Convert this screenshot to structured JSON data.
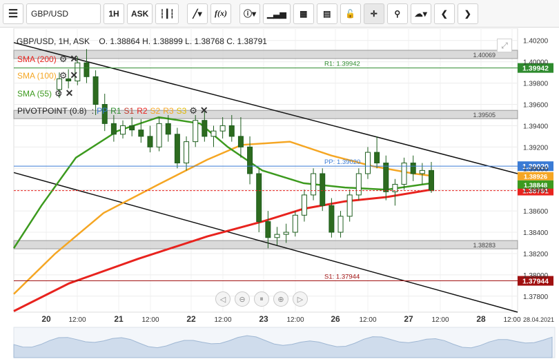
{
  "toolbar": {
    "menu_icon": "hamburger-icon",
    "symbol": "GBP/USD",
    "timeframe": "1H",
    "price_type": "ASK",
    "icons": [
      "candles-icon",
      "draw-icon",
      "fx-icon",
      "info-icon",
      "volume-icon",
      "calendar-icon",
      "news-icon",
      "lock-icon",
      "crosshair-icon",
      "zoom-icon",
      "cloud-icon",
      "prev-icon",
      "next-icon"
    ],
    "fx_label": "f(x)"
  },
  "header": {
    "instrument": "GBP/USD, 1H, ASK",
    "ohlc": "O. 1.38864 H. 1.38899 L. 1.38768 C. 1.38791"
  },
  "indicators": [
    {
      "label": "SMA (200)",
      "color": "#e8231e"
    },
    {
      "label": "SMA (100)",
      "color": "#f5a623"
    },
    {
      "label": "SMA (55)",
      "color": "#3c9a1e"
    }
  ],
  "pivot": {
    "label": "PIVOTPOINT (0.8)",
    "items": [
      {
        "label": "PP",
        "color": "#3a7bd5"
      },
      {
        "label": "R1",
        "color": "#2e8b2e"
      },
      {
        "label": "S1",
        "color": "#c0392b"
      },
      {
        "label": "R2",
        "color": "#e8231e"
      },
      {
        "label": "S2",
        "color": "#f5a623"
      },
      {
        "label": "R3",
        "color": "#f5a623"
      },
      {
        "label": "S3",
        "color": "#f5c518"
      }
    ]
  },
  "chart_data": {
    "type": "line",
    "title": "GBP/USD, 1H, ASK",
    "ylim": [
      1.3765,
      1.4025
    ],
    "x_tick_labels": [
      "20",
      "12:00",
      "21",
      "12:00",
      "22",
      "12:00",
      "23",
      "12:00",
      "26",
      "12:00",
      "27",
      "12:00",
      "28",
      "12:00",
      "28.04.2021"
    ],
    "y_tick_labels": [
      "1.40200",
      "1.40000",
      "1.39800",
      "1.39600",
      "1.39400",
      "1.39200",
      "1.39000",
      "1.38800",
      "1.38600",
      "1.38400",
      "1.38200",
      "1.38000",
      "1.37800"
    ],
    "y_ticks": [
      1.402,
      1.4,
      1.398,
      1.396,
      1.394,
      1.392,
      1.39,
      1.388,
      1.386,
      1.384,
      1.382,
      1.38,
      1.378
    ],
    "levels": [
      {
        "name": "R1",
        "label": "R1: 1.39942",
        "value": 1.39942,
        "tag": "1.39942",
        "color": "#2e8b2e"
      },
      {
        "name": "PP",
        "label": "PP: 1.39020",
        "value": 1.3902,
        "tag": "1.39020",
        "color": "#3a7bd5"
      },
      {
        "name": "S1",
        "label": "S1: 1.37944",
        "value": 1.37944,
        "tag": "1.37944",
        "color": "#a01010"
      },
      {
        "name": "Close",
        "label": "",
        "value": 1.38791,
        "tag": "1.38791",
        "color": "#e8231e"
      }
    ],
    "sma_tags": [
      {
        "name": "SMA (100)",
        "value": 1.38926,
        "tag": "1.38926",
        "color": "#f5a623"
      },
      {
        "name": "SMA (55)",
        "value": 1.38848,
        "tag": "1.38848",
        "color": "#3c9a1e"
      }
    ],
    "zones": [
      {
        "label": "1.40069",
        "value": 1.40069
      },
      {
        "label": "1.39505",
        "value": 1.39505
      },
      {
        "label": "1.38283",
        "value": 1.38283
      }
    ],
    "candles": [
      [
        1.3974,
        1.399,
        1.3966,
        1.3984
      ],
      [
        1.3984,
        1.3993,
        1.3975,
        1.3982
      ],
      [
        1.3982,
        1.4005,
        1.3978,
        1.3999
      ],
      [
        1.3999,
        1.4012,
        1.398,
        1.3986
      ],
      [
        1.3986,
        1.3992,
        1.395,
        1.396
      ],
      [
        1.396,
        1.397,
        1.3935,
        1.3942
      ],
      [
        1.3942,
        1.395,
        1.3925,
        1.3932
      ],
      [
        1.3932,
        1.3945,
        1.3928,
        1.394
      ],
      [
        1.394,
        1.3948,
        1.393,
        1.3936
      ],
      [
        1.3936,
        1.3946,
        1.3924,
        1.393
      ],
      [
        1.393,
        1.394,
        1.3915,
        1.392
      ],
      [
        1.392,
        1.3948,
        1.3916,
        1.3942
      ],
      [
        1.3942,
        1.395,
        1.3925,
        1.3932
      ],
      [
        1.3932,
        1.3938,
        1.39,
        1.3905
      ],
      [
        1.3905,
        1.393,
        1.3898,
        1.3925
      ],
      [
        1.3925,
        1.395,
        1.392,
        1.3945
      ],
      [
        1.3945,
        1.3955,
        1.3925,
        1.393
      ],
      [
        1.393,
        1.394,
        1.392,
        1.3935
      ],
      [
        1.3935,
        1.3948,
        1.3928,
        1.394
      ],
      [
        1.394,
        1.395,
        1.3925,
        1.393
      ],
      [
        1.393,
        1.3948,
        1.391,
        1.392
      ],
      [
        1.392,
        1.393,
        1.3885,
        1.3895
      ],
      [
        1.3895,
        1.39,
        1.384,
        1.385
      ],
      [
        1.385,
        1.386,
        1.3825,
        1.3835
      ],
      [
        1.3835,
        1.3845,
        1.3828,
        1.3838
      ],
      [
        1.3838,
        1.3848,
        1.383,
        1.384
      ],
      [
        1.384,
        1.386,
        1.3836,
        1.3856
      ],
      [
        1.3856,
        1.388,
        1.385,
        1.3875
      ],
      [
        1.3875,
        1.39,
        1.387,
        1.3895
      ],
      [
        1.3895,
        1.39,
        1.386,
        1.3865
      ],
      [
        1.3865,
        1.3872,
        1.3835,
        1.384
      ],
      [
        1.384,
        1.386,
        1.3835,
        1.3855
      ],
      [
        1.3855,
        1.388,
        1.385,
        1.3875
      ],
      [
        1.3875,
        1.39,
        1.387,
        1.3895
      ],
      [
        1.3895,
        1.392,
        1.389,
        1.3915
      ],
      [
        1.3915,
        1.393,
        1.39,
        1.3905
      ],
      [
        1.3905,
        1.3912,
        1.387,
        1.3878
      ],
      [
        1.3878,
        1.389,
        1.3865,
        1.3885
      ],
      [
        1.3885,
        1.391,
        1.388,
        1.3905
      ],
      [
        1.3905,
        1.3912,
        1.3888,
        1.3895
      ],
      [
        1.3895,
        1.3905,
        1.3885,
        1.3898
      ],
      [
        1.3898,
        1.3906,
        1.3877,
        1.3879
      ]
    ]
  },
  "footer_date": "28.04.2021"
}
